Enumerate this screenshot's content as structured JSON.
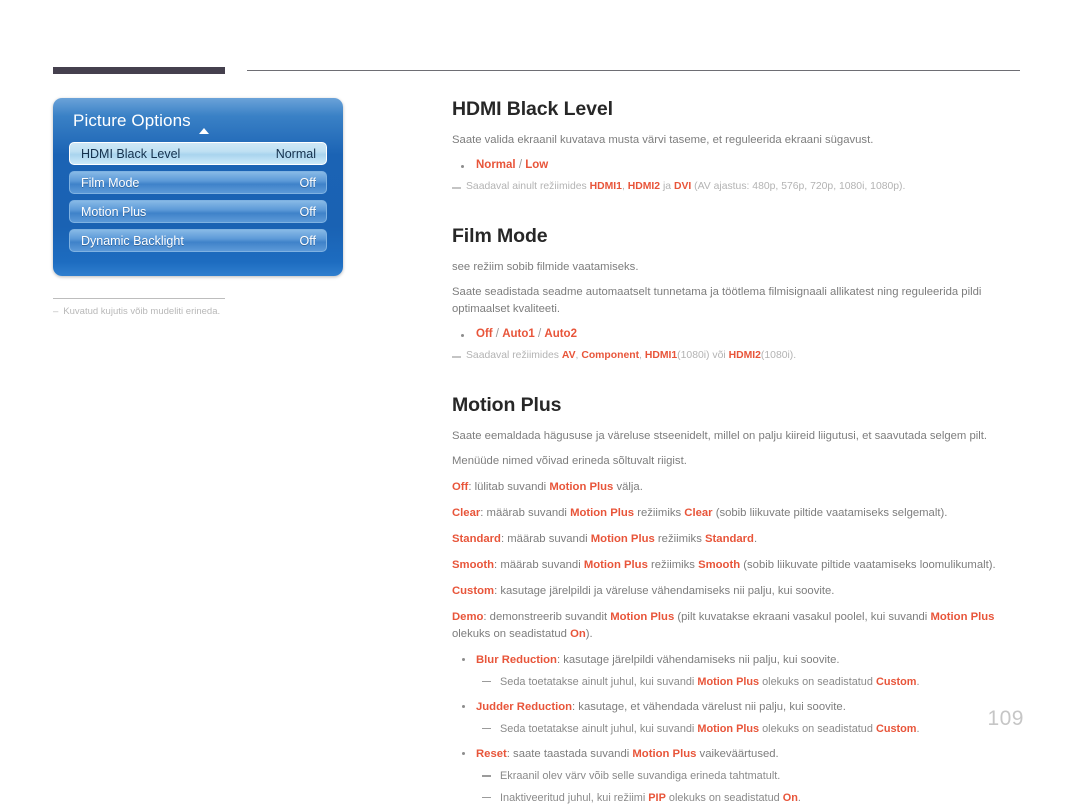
{
  "page": {
    "number": "109"
  },
  "osd": {
    "title": "Picture Options",
    "caret_icon": "caret-up-icon",
    "rows": [
      {
        "label": "HDMI Black Level",
        "value": "Normal",
        "selected": true
      },
      {
        "label": "Film Mode",
        "value": "Off",
        "selected": false
      },
      {
        "label": "Motion Plus",
        "value": "Off",
        "selected": false
      },
      {
        "label": "Dynamic Backlight",
        "value": "Off",
        "selected": false
      }
    ],
    "note": {
      "dash": "–",
      "text": "Kuvatud kujutis võib mudeliti erineda."
    }
  },
  "sections": {
    "hdmi_black_level": {
      "title": "HDMI Black Level",
      "description": "Saate valida ekraanil kuvatava musta värvi taseme, et reguleerida ekraani sügavust.",
      "options": {
        "opt1": "Normal",
        "sep1": " / ",
        "opt2": "Low"
      },
      "availability": {
        "prefix": "Saadaval ainult režiimides ",
        "b1": "HDMI1",
        "mid1": ", ",
        "b2": "HDMI2",
        "mid2": " ja ",
        "b3": "DVI",
        "suffix": " (AV ajastus: 480p, 576p, 720p, 1080i, 1080p)."
      }
    },
    "film_mode": {
      "title": "Film Mode",
      "description1": "see režiim sobib filmide vaatamiseks.",
      "description2": "Saate seadistada seadme automaatselt tunnetama ja töötlema filmisignaali allikatest ning reguleerida pildi optimaalset kvaliteeti.",
      "options": {
        "opt1": "Off",
        "sep1": " / ",
        "opt2": "Auto1",
        "sep2": " / ",
        "opt3": "Auto2"
      },
      "availability": {
        "prefix": "Saadaval režiimides ",
        "b1": "AV",
        "mid1": ", ",
        "b2": "Component",
        "mid2": ", ",
        "b3": "HDMI1",
        "mid3": "(1080i) või ",
        "b4": "HDMI2",
        "suffix": "(1080i)."
      }
    },
    "motion_plus": {
      "title": "Motion Plus",
      "description1": "Saate eemaldada hägususe ja väreluse stseenidelt, millel on palju kiireid liigutusi, et saavutada selgem pilt.",
      "description2": "Menüüde nimed võivad erineda sõltuvalt riigist.",
      "modes": [
        {
          "name": "Off",
          "p1": ": lülitab suvandi ",
          "b1": "Motion Plus",
          "p2": " välja."
        },
        {
          "name": "Clear",
          "p1": ": määrab suvandi ",
          "b1": "Motion Plus",
          "p2": " režiimiks ",
          "b2": "Clear",
          "p3": " (sobib liikuvate piltide vaatamiseks selgemalt)."
        },
        {
          "name": "Standard",
          "p1": ": määrab suvandi ",
          "b1": "Motion Plus",
          "p2": " režiimiks ",
          "b2": "Standard",
          "p3": "."
        },
        {
          "name": "Smooth",
          "p1": ": määrab suvandi ",
          "b1": "Motion Plus",
          "p2": " režiimiks ",
          "b2": "Smooth",
          "p3": " (sobib liikuvate piltide vaatamiseks loomulikumalt)."
        },
        {
          "name": "Custom",
          "p1": ": kasutage järelpildi ja väreluse vähendamiseks nii palju, kui soovite.",
          "b1": "",
          "p2": "",
          "b2": "",
          "p3": ""
        },
        {
          "name": "Demo",
          "p1": ": demonstreerib suvandit ",
          "b1": "Motion Plus",
          "p2": " (pilt kuvatakse ekraani vasakul poolel, kui suvandi ",
          "b2": "Motion Plus",
          "p3": " olekuks on seadistatud ",
          "b3": "On",
          "p4": ")."
        }
      ],
      "bullets": [
        {
          "name": "Blur Reduction",
          "text": ": kasutage järelpildi vähendamiseks nii palju, kui soovite.",
          "sub": [
            {
              "p1": "Seda toetatakse ainult juhul, kui suvandi ",
              "b1": "Motion Plus",
              "p2": " olekuks on seadistatud ",
              "b2": "Custom",
              "p3": "."
            }
          ]
        },
        {
          "name": "Judder Reduction",
          "text": ": kasutage, et vähendada värelust nii palju, kui soovite.",
          "sub": [
            {
              "p1": "Seda toetatakse ainult juhul, kui suvandi ",
              "b1": "Motion Plus",
              "p2": " olekuks on seadistatud ",
              "b2": "Custom",
              "p3": "."
            }
          ]
        },
        {
          "name": "Reset",
          "text_pre": ": saate taastada suvandi ",
          "b1": "Motion Plus",
          "text_post": " vaikeväärtused.",
          "sub": [
            {
              "p1": "Ekraanil olev värv võib selle suvandiga erineda tahtmatult.",
              "b1": "",
              "p2": "",
              "b2": "",
              "p3": ""
            },
            {
              "p1": "Inaktiveeritud juhul, kui režiimi ",
              "b1": "PIP",
              "p2": " olekuks on seadistatud ",
              "b2": "On",
              "p3": "."
            }
          ]
        }
      ]
    }
  },
  "colors": {
    "accent_orange": "#e8553a",
    "osd_blue": "#1a62b3",
    "header_bar": "#45404e",
    "page_number": "#c6c6c6"
  }
}
